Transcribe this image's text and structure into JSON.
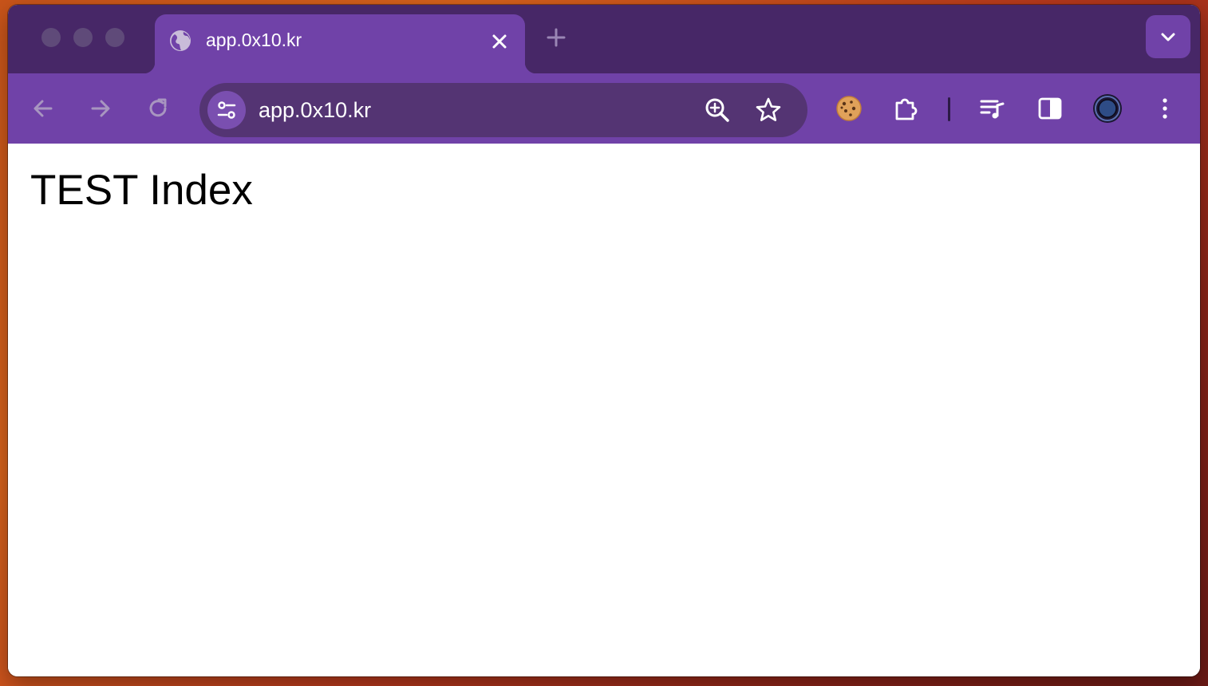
{
  "browser": {
    "tab": {
      "title": "app.0x10.kr"
    },
    "address_bar": {
      "url": "app.0x10.kr"
    },
    "colors": {
      "accent": "#7042a8",
      "tabstrip": "#472767",
      "omnibox": "#543473"
    }
  },
  "page": {
    "heading": "TEST Index"
  },
  "icons": [
    "globe-icon",
    "close-icon",
    "plus-icon",
    "chevron-down-icon",
    "back-arrow-icon",
    "forward-arrow-icon",
    "reload-icon",
    "site-settings-icon",
    "zoom-icon",
    "star-icon",
    "cookie-icon",
    "puzzle-icon",
    "media-queue-icon",
    "side-panel-icon",
    "profile-icon",
    "kebab-menu-icon"
  ]
}
